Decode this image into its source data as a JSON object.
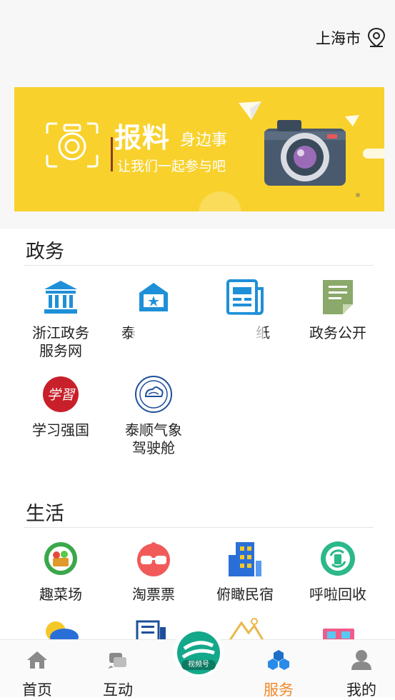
{
  "location": {
    "city": "上海市",
    "icon": "location-pin-icon"
  },
  "banner": {
    "title": "报料",
    "subtitle": "身边事",
    "tagline": "让我们一起参与吧",
    "colors": {
      "background": "#f8d12c",
      "camera_body": "#4a5a6e",
      "lens": "#9b6bb8"
    }
  },
  "sections": [
    {
      "title": "政务",
      "items": [
        {
          "label": "浙江政务\n服务网",
          "icon": "government-building-icon",
          "color": "#1e90d8"
        },
        {
          "label": "泰",
          "icon": "badge-house-icon",
          "color": "#1e90d8"
        },
        {
          "label": "纸",
          "icon": "newspaper-icon",
          "color": "#1e90d8"
        },
        {
          "label": "政务公开",
          "icon": "document-icon",
          "color": "#8aa96a"
        },
        {
          "label": "学习强国",
          "icon": "xuexi-logo-icon",
          "color": "#c8202a"
        },
        {
          "label": "泰顺气象\n驾驶舱",
          "icon": "weather-seal-icon",
          "color": "#1e4f9a"
        }
      ]
    },
    {
      "title": "生活",
      "items": [
        {
          "label": "趣菜场",
          "icon": "vegetable-basket-icon",
          "color": "#3aa84a"
        },
        {
          "label": "淘票票",
          "icon": "glasses-mascot-icon",
          "color": "#f25a5a"
        },
        {
          "label": "俯瞰民宿",
          "icon": "building-icon",
          "color": "#2a6fd8"
        },
        {
          "label": "呼啦回收",
          "icon": "recycle-icon",
          "color": "#2bb88a"
        }
      ]
    }
  ],
  "navbar": {
    "items": [
      {
        "label": "首页",
        "icon": "home-icon"
      },
      {
        "label": "互动",
        "icon": "interact-icon"
      },
      {
        "label": "视频号",
        "icon": "video-channel-icon"
      },
      {
        "label": "服务",
        "icon": "service-cubes-icon",
        "active": true
      },
      {
        "label": "我的",
        "icon": "person-icon"
      }
    ],
    "active_color": "#f08a2b"
  }
}
